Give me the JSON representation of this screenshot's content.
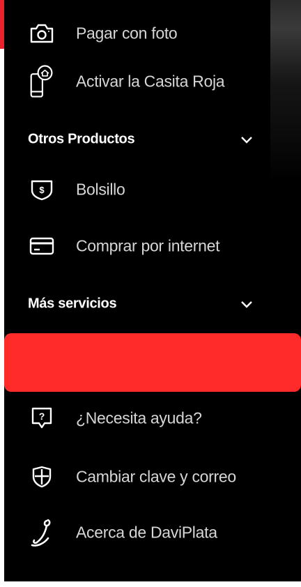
{
  "menu": {
    "items_top": [
      {
        "label": "Pagar con foto",
        "icon": "camera-icon"
      },
      {
        "label": "Activar la Casita Roja",
        "icon": "phone-house-icon"
      }
    ],
    "sections": [
      {
        "title": "Otros Productos",
        "icon": "chevron-down-icon"
      },
      {
        "title": "Más servicios",
        "icon": "chevron-down-icon"
      }
    ],
    "items_products": [
      {
        "label": "Bolsillo",
        "icon": "pocket-shield-icon"
      },
      {
        "label": "Comprar por internet",
        "icon": "credit-card-icon"
      }
    ],
    "items_services": [
      {
        "label": "¿Necesita ayuda?",
        "icon": "help-bubble-icon"
      },
      {
        "label": "Cambiar clave y correo",
        "icon": "shield-icon"
      },
      {
        "label": "Acerca de DaviPlata",
        "icon": "daviplata-logo-icon"
      }
    ]
  },
  "colors": {
    "accent_red": "#ff2b2b",
    "background": "#000000",
    "text": "#d6d6d6"
  }
}
